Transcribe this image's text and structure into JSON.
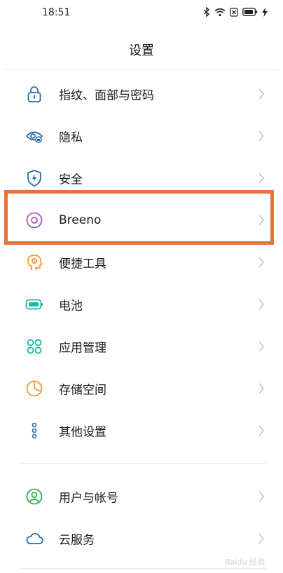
{
  "status_bar": {
    "time": "18:51"
  },
  "header": {
    "title": "设置"
  },
  "items": [
    {
      "label": "指纹、面部与密码",
      "icon": "lock-icon",
      "color": "#2b6ca3"
    },
    {
      "label": "隐私",
      "icon": "privacy-eye-icon",
      "color": "#2b6ca3"
    },
    {
      "label": "安全",
      "icon": "shield-icon",
      "color": "#2b6ca3"
    },
    {
      "label": "Breeno",
      "icon": "breeno-icon",
      "color": "#c04aa0"
    },
    {
      "label": "便捷工具",
      "icon": "head-tool-icon",
      "color": "#f29a2e"
    },
    {
      "label": "电池",
      "icon": "battery-icon",
      "color": "#19b9a3"
    },
    {
      "label": "应用管理",
      "icon": "app-grid-icon",
      "color": "#19b9a3"
    },
    {
      "label": "存储空间",
      "icon": "storage-pie-icon",
      "color": "#f29a2e"
    },
    {
      "label": "其他设置",
      "icon": "more-settings-icon",
      "color": "#2b6ca3"
    },
    {
      "label": "用户与帐号",
      "icon": "user-icon",
      "color": "#2bb04c"
    },
    {
      "label": "云服务",
      "icon": "cloud-icon",
      "color": "#2b6ca3"
    }
  ],
  "highlight_color": "#e8723a",
  "watermark": "Baidu 经验"
}
